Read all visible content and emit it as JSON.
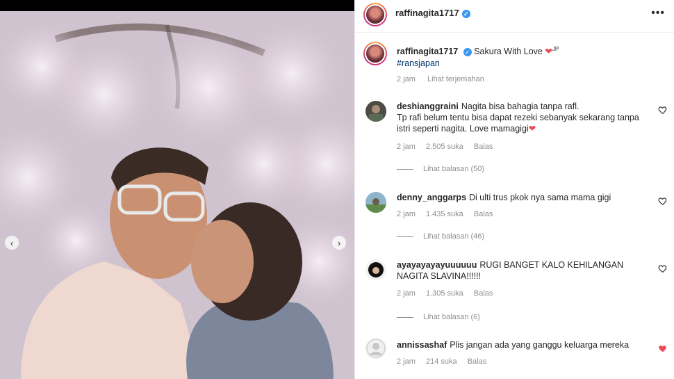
{
  "post": {
    "username": "raffinagita1717",
    "caption": "Sakura With Love",
    "caption_suffix": "JP",
    "hashtag": "#ransjapan",
    "time": "2 jam",
    "translate": "Lihat terjemahan"
  },
  "comments": [
    {
      "username": "deshianggraini",
      "text": "Nagita bisa bahagia tanpa rafl.\nTp rafi belum tentu bisa dapat rezeki sebanyak sekarang tanpa istri seperti nagita. Love mamagigi",
      "has_heart_emoji": true,
      "time": "2 jam",
      "likes": "2.505 suka",
      "reply": "Balas",
      "replies_label": "Lihat balasan (50)",
      "liked": false
    },
    {
      "username": "denny_anggarps",
      "text": "Di ulti trus pkok nya sama mama gigi",
      "has_heart_emoji": false,
      "time": "2 jam",
      "likes": "1.435 suka",
      "reply": "Balas",
      "replies_label": "Lihat balasan (46)",
      "liked": false
    },
    {
      "username": "ayayayayayuuuuuu",
      "text": "RUGI BANGET KALO KEHILANGAN NAGITA SLAVINA!!!!!!",
      "has_heart_emoji": false,
      "time": "2 jam",
      "likes": "1.305 suka",
      "reply": "Balas",
      "replies_label": "Lihat balasan (6)",
      "liked": false
    },
    {
      "username": "annissashaf",
      "text": "Plis jangan ada yang ganggu keluarga mereka",
      "has_heart_emoji": false,
      "time": "2 jam",
      "likes": "214 suka",
      "reply": "Balas",
      "replies_label": "",
      "liked": true
    }
  ],
  "colors": {
    "verified": "#3897f0",
    "like_red": "#ed4956",
    "muted": "#8e8e8e",
    "hashtag": "#00376b"
  }
}
